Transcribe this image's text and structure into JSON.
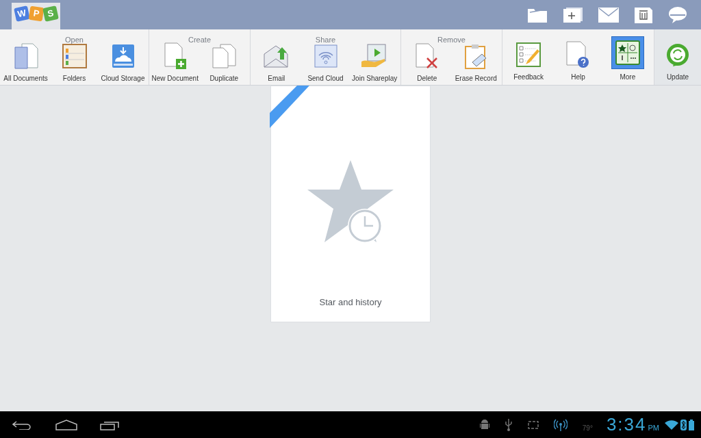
{
  "logo": {
    "letters": [
      "W",
      "P",
      "S"
    ]
  },
  "toolbar": {
    "groups": [
      {
        "title": "Open",
        "items": [
          {
            "label": "All Documents",
            "selected": false
          },
          {
            "label": "Folders",
            "selected": false
          },
          {
            "label": "Cloud Storage",
            "selected": false
          }
        ]
      },
      {
        "title": "Create",
        "items": [
          {
            "label": "New Document",
            "selected": false
          },
          {
            "label": "Duplicate",
            "selected": false
          }
        ]
      },
      {
        "title": "Share",
        "items": [
          {
            "label": "Email",
            "selected": false
          },
          {
            "label": "Send Cloud",
            "selected": false
          },
          {
            "label": "Join Shareplay",
            "selected": false
          }
        ]
      },
      {
        "title": "Remove",
        "items": [
          {
            "label": "Delete",
            "selected": false
          },
          {
            "label": "Erase Record",
            "selected": false
          }
        ]
      },
      {
        "items": [
          {
            "label": "Feedback",
            "selected": false
          },
          {
            "label": "Help",
            "selected": false
          },
          {
            "label": "More",
            "selected": true
          }
        ]
      }
    ],
    "update": {
      "label": "Update"
    }
  },
  "card": {
    "label": "Star and history"
  },
  "status_bar": {
    "temperature": "79°",
    "time": "3:34",
    "ampm": "PM"
  }
}
